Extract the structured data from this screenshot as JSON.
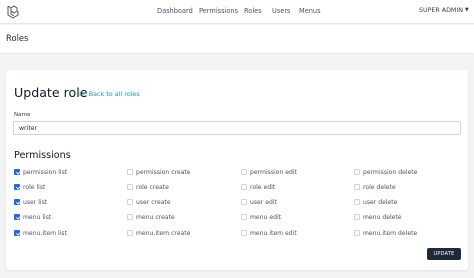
{
  "nav": {
    "links": [
      "Dashboard",
      "Permissions",
      "Roles",
      "Users",
      "Menus"
    ],
    "user": "SUPER ADMIN"
  },
  "header": {
    "title": "Roles"
  },
  "form": {
    "heading": "Update role",
    "back_link": "<< Back to all roles",
    "name_label": "Name",
    "name_value": "writer",
    "permissions_heading": "Permissions",
    "submit_label": "UPDATE"
  },
  "permissions": [
    {
      "label": "permission list",
      "checked": true
    },
    {
      "label": "permission create",
      "checked": false
    },
    {
      "label": "permission edit",
      "checked": false
    },
    {
      "label": "permission delete",
      "checked": false
    },
    {
      "label": "role list",
      "checked": true
    },
    {
      "label": "role create",
      "checked": false
    },
    {
      "label": "role edit",
      "checked": false
    },
    {
      "label": "role delete",
      "checked": false
    },
    {
      "label": "user list",
      "checked": true
    },
    {
      "label": "user create",
      "checked": false
    },
    {
      "label": "user edit",
      "checked": false
    },
    {
      "label": "user delete",
      "checked": false
    },
    {
      "label": "menu list",
      "checked": true
    },
    {
      "label": "menu create",
      "checked": false
    },
    {
      "label": "menu edit",
      "checked": false
    },
    {
      "label": "menu delete",
      "checked": false
    },
    {
      "label": "menu.item list",
      "checked": true
    },
    {
      "label": "menu.item create",
      "checked": false
    },
    {
      "label": "menu.item edit",
      "checked": false
    },
    {
      "label": "menu.item delete",
      "checked": false
    }
  ],
  "colors": {
    "accent": "#2563eb",
    "link": "#0e9fad",
    "button": "#1f2937"
  },
  "icons": {
    "logo": "laravel-logo-icon",
    "user_menu": "chevron-down-icon"
  }
}
